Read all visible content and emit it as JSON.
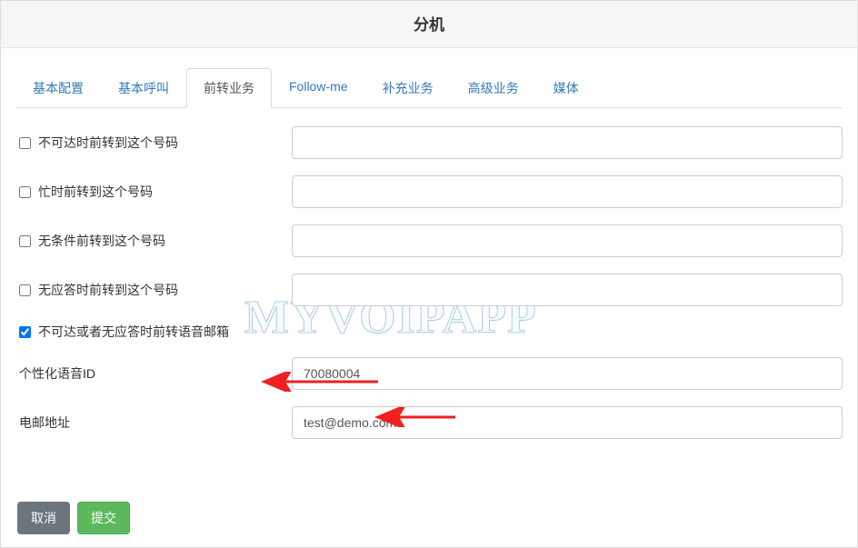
{
  "header": {
    "title": "分机"
  },
  "tabs": [
    {
      "label": "基本配置"
    },
    {
      "label": "基本呼叫"
    },
    {
      "label": "前转业务"
    },
    {
      "label": "Follow-me"
    },
    {
      "label": "补充业务"
    },
    {
      "label": "高级业务"
    },
    {
      "label": "媒体"
    }
  ],
  "form": {
    "rows": [
      {
        "label": "不可达时前转到这个号码",
        "checked": false,
        "value": "",
        "has_checkbox": true,
        "has_input": true
      },
      {
        "label": "忙时前转到这个号码",
        "checked": false,
        "value": "",
        "has_checkbox": true,
        "has_input": true
      },
      {
        "label": "无条件前转到这个号码",
        "checked": false,
        "value": "",
        "has_checkbox": true,
        "has_input": true
      },
      {
        "label": "无应答时前转到这个号码",
        "checked": false,
        "value": "",
        "has_checkbox": true,
        "has_input": true
      },
      {
        "label": "不可达或者无应答时前转语音邮箱",
        "checked": true,
        "value": "",
        "has_checkbox": true,
        "has_input": false
      },
      {
        "label": "个性化语音ID",
        "checked": false,
        "value": "70080004",
        "has_checkbox": false,
        "has_input": true
      },
      {
        "label": "电邮地址",
        "checked": false,
        "value": "test@demo.com",
        "has_checkbox": false,
        "has_input": true
      }
    ]
  },
  "footer": {
    "cancel_label": "取消",
    "submit_label": "提交"
  },
  "watermark": "MYVOIPAPP"
}
